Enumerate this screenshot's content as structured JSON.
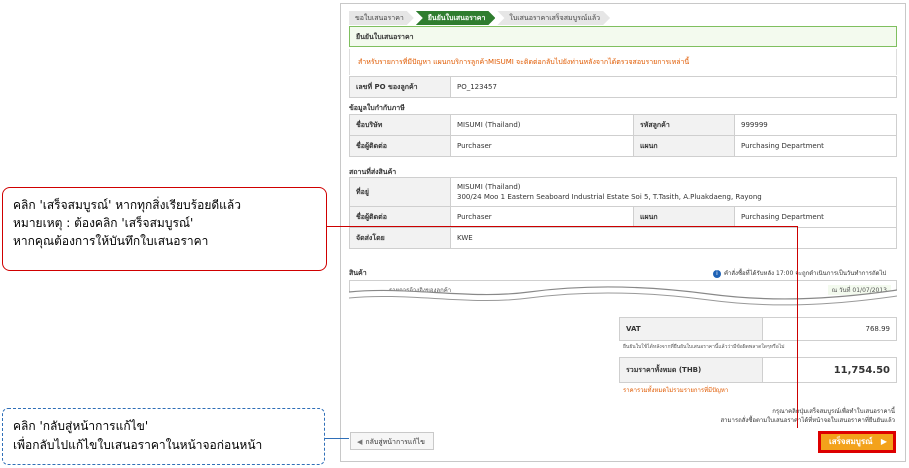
{
  "steps": [
    "ขอใบเสนอราคา",
    "ยืนยันใบเสนอราคา",
    "ใบเสนอราคาเสร็จสมบูรณ์แล้ว"
  ],
  "header_title": "ยืนยันใบเสนอราคา",
  "notice": "สำหรับรายการที่มีปัญหา แผนกบริการลูกค้าMISUMI จะติดต่อกลับไปยังท่านหลังจากได้ตรวจสอบรายการเหล่านี้",
  "po": {
    "label": "เลขที่ PO ของลูกค้า",
    "value": "PO_123457"
  },
  "billing": {
    "title": "ข้อมูลใบกำกับภาษี",
    "company_label": "ชื่อบริษัท",
    "company": "MISUMI (Thailand)",
    "customer_code_label": "รหัสลูกค้า",
    "customer_code": "999999",
    "contact_label": "ชื่อผู้ติดต่อ",
    "contact": "Purchaser",
    "dept_label": "แผนก",
    "dept": "Purchasing Department"
  },
  "shipping": {
    "title": "สถานที่ส่งสินค้า",
    "address_label": "ที่อยู่",
    "address_line1": "MISUMI (Thailand)",
    "address_line2": "300/24 Moo 1 Eastern Seaboard Industrial Estate Soi 5, T.Tasith, A.Pluakdaeng, Rayong",
    "contact_label": "ชื่อผู้ติดต่อ",
    "contact": "Purchaser",
    "dept_label": "แผนก",
    "dept": "Purchasing Department",
    "carrier_label": "จัดส่งโดย",
    "carrier": "KWE"
  },
  "products": {
    "title": "สินค้า",
    "info_icon": "i",
    "info_text": "คำสั่งซื้อที่ได้รับหลัง 17:00 จะถูกดำเนินการเป็นวันทำการถัดไป",
    "col_ref": "รายการอ้างอิงของลูกค้า",
    "date_note": "ณ วันที่ 01/07/2013"
  },
  "totals": {
    "vat_label": "VAT",
    "vat_value": "768.99",
    "note": "ยืนยันใบใช้ได้หลังจากที่ยืนยันใบเสนอราคานี้แล้วว่ามีข้อผิดพลาดใดๆหรือไม่",
    "total_label": "รวมราคาทั้งหมด (THB)",
    "total_value": "11,754.50",
    "total_note": "ราคารวมทั้งหมดไม่รวมรายการที่มีปัญหา"
  },
  "bottom_note_line1": "กรุณาคลิกปุ่มเสร็จสมบูรณ์เพื่อทำใบเสนอราคานี้",
  "bottom_note_line2": "สามารถสั่งซื้อตามใบเสนอราคาได้ที่หน้าจอใบเสนอราคาที่ยืนยันแล้ว",
  "back_button": "กลับสู่หน้าการแก้ไข",
  "complete_button": "เสร็จสมบูรณ์",
  "callout_red": {
    "line1": "คลิก 'เสร็จสมบูรณ์' หากทุกสิ่งเรียบร้อยดีแล้ว",
    "line2": "หมายเหตุ : ต้องคลิก 'เสร็จสมบูรณ์'",
    "line3": "หากคุณต้องการให้บันทึกใบเสนอราคา"
  },
  "callout_blue": {
    "line1": "คลิก 'กลับสู่หน้าการแก้ไข'",
    "line2": "เพื่อกลับไปแก้ไขใบเสนอราคาในหน้าจอก่อนหน้า"
  },
  "colors": {
    "accent_green": "#2f7d2f",
    "button_orange": "#f3a21b",
    "highlight_red": "#d00000",
    "warn_orange": "#e05a00"
  }
}
